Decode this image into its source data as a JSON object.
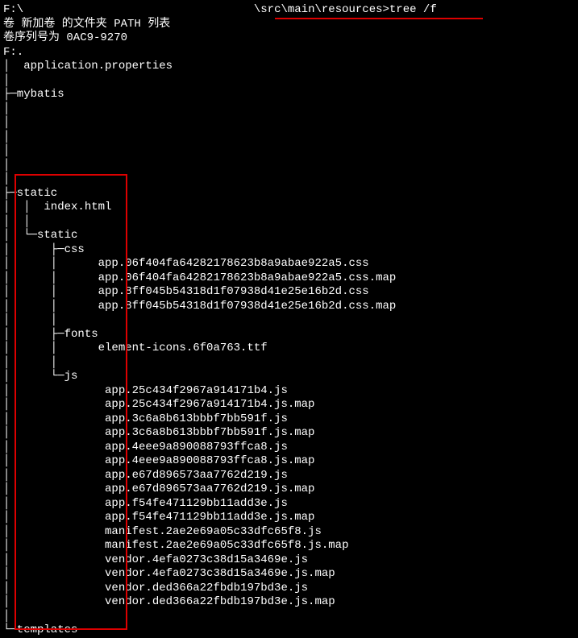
{
  "prompt": {
    "drive": "F:\\",
    "path_suffix": "\\src\\main\\resources>",
    "command": "tree /f"
  },
  "header": {
    "line1": "卷 新加卷 的文件夹 PATH 列表",
    "line2": "卷序列号为 0AC9-9270",
    "line3": "F:."
  },
  "tree": {
    "app_properties": "│  application.properties",
    "blank_pipe": "│",
    "mybatis": "├─mybatis",
    "static1": "├─static",
    "index_html": "│  │  index.html",
    "static2": "│  └─static",
    "css": "│      ├─css",
    "css_files": [
      "│      │      app.06f404fa64282178623b8a9abae922a5.css",
      "│      │      app.06f404fa64282178623b8a9abae922a5.css.map",
      "│      │      app.8ff045b54318d1f07938d41e25e16b2d.css",
      "│      │      app.8ff045b54318d1f07938d41e25e16b2d.css.map"
    ],
    "css_blank": "│      │",
    "fonts": "│      ├─fonts",
    "fonts_files": [
      "│      │      element-icons.6f0a763.ttf"
    ],
    "js": "│      └─js",
    "js_files": [
      "│              app.25c434f2967a914171b4.js",
      "│              app.25c434f2967a914171b4.js.map",
      "│              app.3c6a8b613bbbf7bb591f.js",
      "│              app.3c6a8b613bbbf7bb591f.js.map",
      "│              app.4eee9a890088793ffca8.js",
      "│              app.4eee9a890088793ffca8.js.map",
      "│              app.e67d896573aa7762d219.js",
      "│              app.e67d896573aa7762d219.js.map",
      "│              app.f54fe471129bb11add3e.js",
      "│              app.f54fe471129bb11add3e.js.map",
      "│              manifest.2ae2e69a05c33dfc65f8.js",
      "│              manifest.2ae2e69a05c33dfc65f8.js.map",
      "│              vendor.4efa0273c38d15a3469e.js",
      "│              vendor.4efa0273c38d15a3469e.js.map",
      "│              vendor.ded366a22fbdb197bd3e.js",
      "│              vendor.ded366a22fbdb197bd3e.js.map"
    ],
    "templates": "└─templates"
  }
}
